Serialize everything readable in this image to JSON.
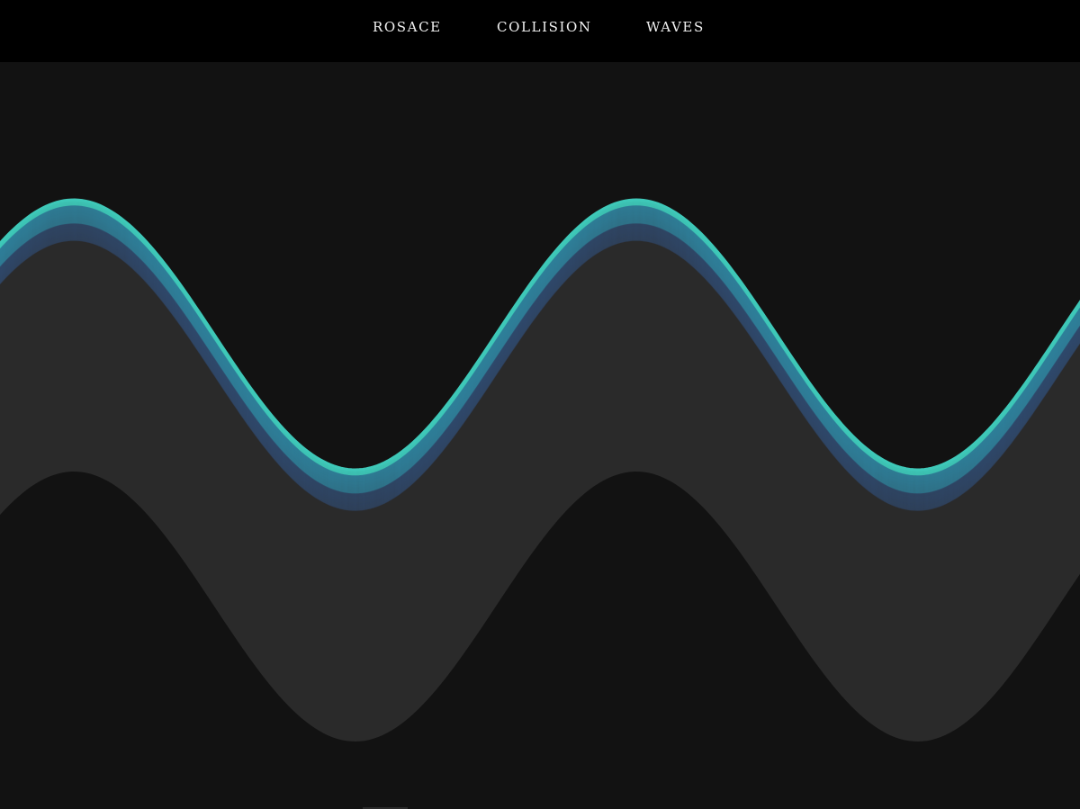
{
  "nav": {
    "items": [
      {
        "label": "ROSACE",
        "id": "rosace"
      },
      {
        "label": "COLLISION",
        "id": "collision"
      },
      {
        "label": "WAVES",
        "id": "waves"
      }
    ]
  },
  "canvas": {
    "background": "#121212",
    "header_background": "#000000",
    "band_color": "#2a2a2a",
    "wave_colors": [
      "#3ec8b8",
      "#2f7f9a",
      "#304a6e"
    ]
  }
}
